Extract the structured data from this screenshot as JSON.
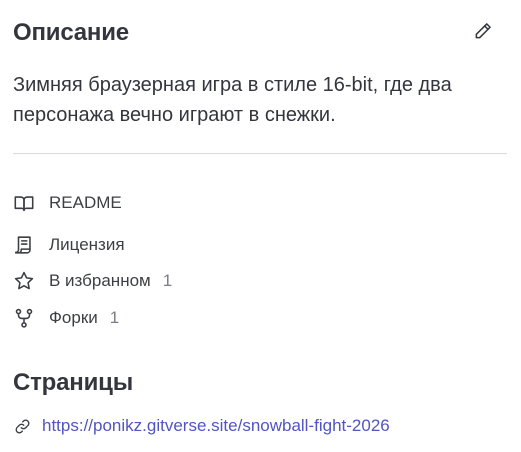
{
  "about": {
    "title": "Описание",
    "edit_icon": "pencil-icon",
    "description": "Зимняя браузерная игра в стиле 16-bit, где два персонажа вечно играют в снежки."
  },
  "meta": {
    "readme": {
      "icon": "book-icon",
      "label": "README"
    },
    "license": {
      "icon": "scroll-icon",
      "label": "Лицензия"
    },
    "stars": {
      "icon": "star-icon",
      "label": "В избранном",
      "count": "1"
    },
    "forks": {
      "icon": "fork-icon",
      "label": "Форки",
      "count": "1"
    }
  },
  "pages": {
    "title": "Страницы",
    "link_icon": "link-icon",
    "url": "https://ponikz.gitverse.site/snowball-fight-2026"
  },
  "colors": {
    "text": "#34363d",
    "muted": "#7b7e86",
    "link": "#5055c0",
    "divider": "#d8dade"
  }
}
